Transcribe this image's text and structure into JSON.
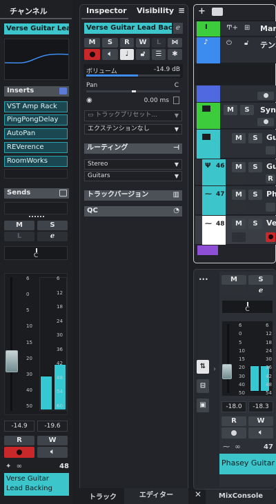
{
  "channel": {
    "tab": "チャンネル",
    "track_name": "Verse Guitar Lead B.",
    "inserts_label": "Inserts",
    "inserts": [
      "VST Amp Rack",
      "PingPongDelay",
      "AutoPan",
      "REVerence",
      "RoomWorks"
    ],
    "sends_label": "Sends",
    "m_label": "M",
    "s_label": "S",
    "l_label": "L",
    "pan_label": "C",
    "fader_scale": [
      "6",
      "0",
      "5",
      "10",
      "15",
      "20",
      "30",
      "40",
      "50"
    ],
    "meter_scale": [
      "6",
      "12",
      "18",
      "24",
      "30",
      "36",
      "42",
      "48",
      "54",
      "60"
    ],
    "volume_readout": "-14.9",
    "peak_readout": "-19.6",
    "r_label": "R",
    "w_label": "W",
    "channel_number": "48",
    "name_footer": "Verse Guitar Lead Backing"
  },
  "inspector": {
    "tab_inspector": "Inspector",
    "tab_visibility": "Visibility",
    "track_name": "Verse Guitar Lead Backing",
    "m_label": "M",
    "s_label": "S",
    "r_label": "R",
    "w_label": "W",
    "l_label": "L",
    "volume_label": "ボリューム",
    "volume_value": "-14.9 dB",
    "volume_level": 0.55,
    "pan_label": "Pan",
    "pan_value": "C",
    "delay_value": "0.00 ms",
    "preset_placeholder": "トラックプリセット...",
    "extension_value": "エクステンションなし",
    "routing_label": "ルーティング",
    "routing_in": "Stereo",
    "routing_out": "Guitars",
    "track_versions_label": "トラックバージョン",
    "qc_label": "QC",
    "bottom_tab_track": "トラック",
    "bottom_tab_editor": "エディター"
  },
  "track_list": {
    "tracks": [
      {
        "name": "Marl",
        "color": "#3ccc3c"
      },
      {
        "name": "テンポ",
        "color": "#3c8cf0"
      },
      {
        "name": "",
        "color": "#5068e0"
      },
      {
        "name": "Synt",
        "color": "#3ccc3c"
      },
      {
        "name": "Gu",
        "color": "#3cc6cc"
      },
      {
        "name": "Gu",
        "number": "46",
        "color": "#3cc6cc"
      },
      {
        "name": "Ph",
        "number": "47",
        "color": "#3cc6cc"
      },
      {
        "name": "Ve",
        "number": "48",
        "color": "#ffffff"
      }
    ],
    "m_label": "M",
    "s_label": "S",
    "r_label": "R"
  },
  "mixconsole": {
    "tab": "MixConsole",
    "m_label": "M",
    "s_label": "S",
    "pan_label": "C",
    "fader_scale": [
      "6",
      "0",
      "5",
      "10",
      "15",
      "20",
      "30",
      "40",
      "50"
    ],
    "meter_scale": [
      "6",
      "12",
      "18",
      "24",
      "30",
      "36",
      "42",
      "48",
      "54"
    ],
    "volume_readout": "-18.0",
    "peak_readout": "-18.3",
    "r_label": "R",
    "w_label": "W",
    "channel_number": "47",
    "channel_name": "Phasey Guitar"
  },
  "colors": {
    "accent": "#3cc6cc",
    "record": "#d42a2a",
    "green": "#3ccc3c"
  }
}
